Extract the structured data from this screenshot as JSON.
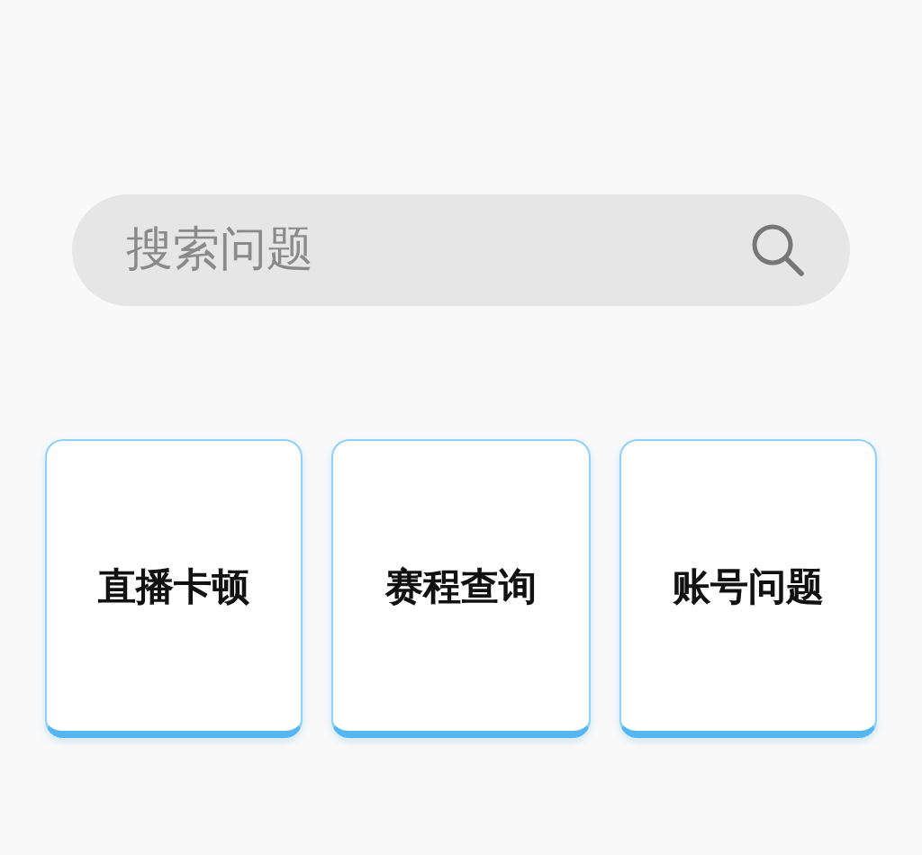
{
  "search": {
    "placeholder": "搜索问题"
  },
  "categories": [
    {
      "label": "直播卡顿"
    },
    {
      "label": "赛程查询"
    },
    {
      "label": "账号问题"
    }
  ]
}
